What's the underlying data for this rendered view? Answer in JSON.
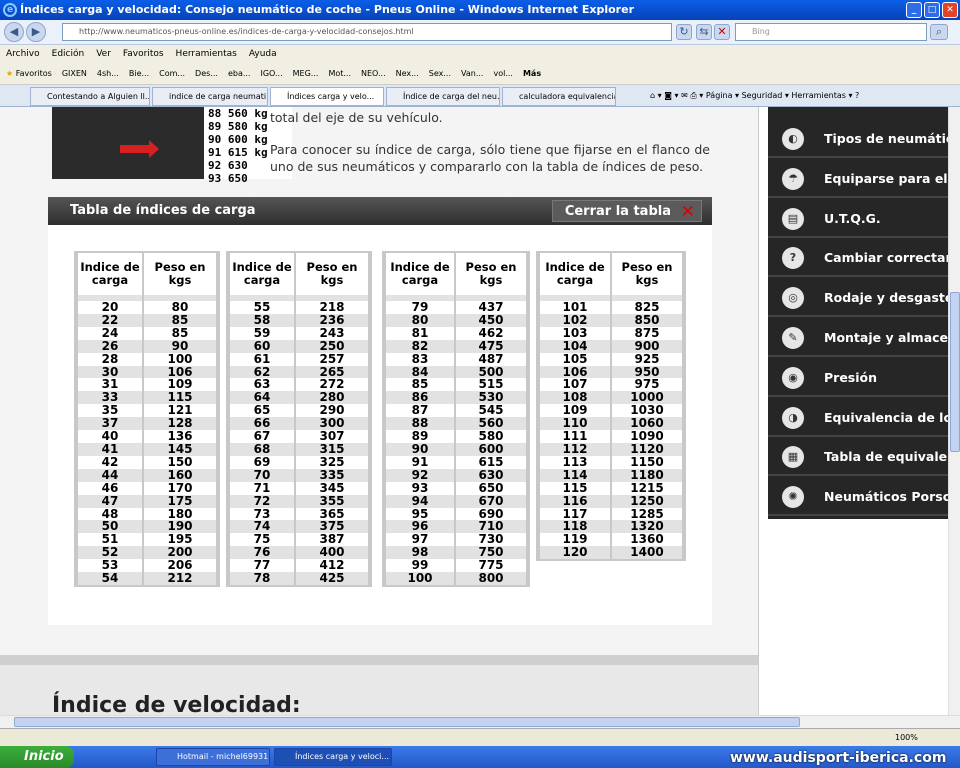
{
  "window": {
    "title": "Índices carga y velocidad: Consejo neumático de coche - Pneus Online - Windows Internet Explorer"
  },
  "address": {
    "url_domain": "http://www.neumaticos-pneus-online.es",
    "url_path": "/indices-de-carga-y-velocidad-consejos.html",
    "search_placeholder": "Bing"
  },
  "menubar": [
    "Archivo",
    "Edición",
    "Ver",
    "Favoritos",
    "Herramientas",
    "Ayuda"
  ],
  "favorites": [
    "Favoritos",
    "GIXEN",
    "4sh...",
    "Bie...",
    "Com...",
    "Des...",
    "eba...",
    "IGO...",
    "MEG...",
    "Mot...",
    "NEO...",
    "Nex...",
    "Sex...",
    "Van...",
    "vol...",
    "Más"
  ],
  "tabs": [
    "Contestando a Alguien ll...",
    "indice de carga neumati...",
    "Índices carga y velo...",
    "Índice de carga del neu...",
    "calculadora equivalencia..."
  ],
  "tab_tools": {
    "page": "Página",
    "security": "Seguridad",
    "tools": "Herramientas"
  },
  "tire_image": {
    "rows": [
      "88   560 kg",
      "89   580 kg",
      "90   600 kg",
      "91   615 kg",
      "92   630",
      "93   650"
    ]
  },
  "intro": {
    "line1": "total del eje de su vehículo.",
    "para2": "Para conocer su índice de carga, sólo tiene que fijarse en el flanco de uno de sus neumáticos y compararlo con la tabla de índices de peso."
  },
  "load_table": {
    "title": "Tabla de índices de carga",
    "close_label": "Cerrar la tabla",
    "header_index": "Indice de carga",
    "header_weight": "Peso en kgs",
    "blocks": [
      [
        [
          "20",
          "80"
        ],
        [
          "22",
          "85"
        ],
        [
          "24",
          "85"
        ],
        [
          "26",
          "90"
        ],
        [
          "28",
          "100"
        ],
        [
          "30",
          "106"
        ],
        [
          "31",
          "109"
        ],
        [
          "33",
          "115"
        ],
        [
          "35",
          "121"
        ],
        [
          "37",
          "128"
        ],
        [
          "40",
          "136"
        ],
        [
          "41",
          "145"
        ],
        [
          "42",
          "150"
        ],
        [
          "44",
          "160"
        ],
        [
          "46",
          "170"
        ],
        [
          "47",
          "175"
        ],
        [
          "48",
          "180"
        ],
        [
          "50",
          "190"
        ],
        [
          "51",
          "195"
        ],
        [
          "52",
          "200"
        ],
        [
          "53",
          "206"
        ],
        [
          "54",
          "212"
        ]
      ],
      [
        [
          "55",
          "218"
        ],
        [
          "58",
          "236"
        ],
        [
          "59",
          "243"
        ],
        [
          "60",
          "250"
        ],
        [
          "61",
          "257"
        ],
        [
          "62",
          "265"
        ],
        [
          "63",
          "272"
        ],
        [
          "64",
          "280"
        ],
        [
          "65",
          "290"
        ],
        [
          "66",
          "300"
        ],
        [
          "67",
          "307"
        ],
        [
          "68",
          "315"
        ],
        [
          "69",
          "325"
        ],
        [
          "70",
          "335"
        ],
        [
          "71",
          "345"
        ],
        [
          "72",
          "355"
        ],
        [
          "73",
          "365"
        ],
        [
          "74",
          "375"
        ],
        [
          "75",
          "387"
        ],
        [
          "76",
          "400"
        ],
        [
          "77",
          "412"
        ],
        [
          "78",
          "425"
        ]
      ],
      [
        [
          "79",
          "437"
        ],
        [
          "80",
          "450"
        ],
        [
          "81",
          "462"
        ],
        [
          "82",
          "475"
        ],
        [
          "83",
          "487"
        ],
        [
          "84",
          "500"
        ],
        [
          "85",
          "515"
        ],
        [
          "86",
          "530"
        ],
        [
          "87",
          "545"
        ],
        [
          "88",
          "560"
        ],
        [
          "89",
          "580"
        ],
        [
          "90",
          "600"
        ],
        [
          "91",
          "615"
        ],
        [
          "92",
          "630"
        ],
        [
          "93",
          "650"
        ],
        [
          "94",
          "670"
        ],
        [
          "95",
          "690"
        ],
        [
          "96",
          "710"
        ],
        [
          "97",
          "730"
        ],
        [
          "98",
          "750"
        ],
        [
          "99",
          "775"
        ],
        [
          "100",
          "800"
        ]
      ],
      [
        [
          "101",
          "825"
        ],
        [
          "102",
          "850"
        ],
        [
          "103",
          "875"
        ],
        [
          "104",
          "900"
        ],
        [
          "105",
          "925"
        ],
        [
          "106",
          "950"
        ],
        [
          "107",
          "975"
        ],
        [
          "108",
          "1000"
        ],
        [
          "109",
          "1030"
        ],
        [
          "110",
          "1060"
        ],
        [
          "111",
          "1090"
        ],
        [
          "112",
          "1120"
        ],
        [
          "113",
          "1150"
        ],
        [
          "114",
          "1180"
        ],
        [
          "115",
          "1215"
        ],
        [
          "116",
          "1250"
        ],
        [
          "117",
          "1285"
        ],
        [
          "118",
          "1320"
        ],
        [
          "119",
          "1360"
        ],
        [
          "120",
          "1400"
        ]
      ]
    ]
  },
  "speed_heading": "Índice de velocidad:",
  "sidebar": [
    "Tipos de neumáticos",
    "Equiparse para el invierno",
    "U.T.Q.G.",
    "Cambiar correctamente",
    "Rodaje y desgaste",
    "Montaje y almacenaje",
    "Presión",
    "Equivalencia de los neumáticos",
    "Tabla de equivalencias",
    "Neumáticos Porsche"
  ],
  "status": {
    "zoom": "100%"
  },
  "taskbar": {
    "start": "Inicio",
    "tasks": [
      "Hotmail - michel69931...",
      "Índices carga y veloci..."
    ],
    "watermark": "www.audisport-iberica.com"
  }
}
